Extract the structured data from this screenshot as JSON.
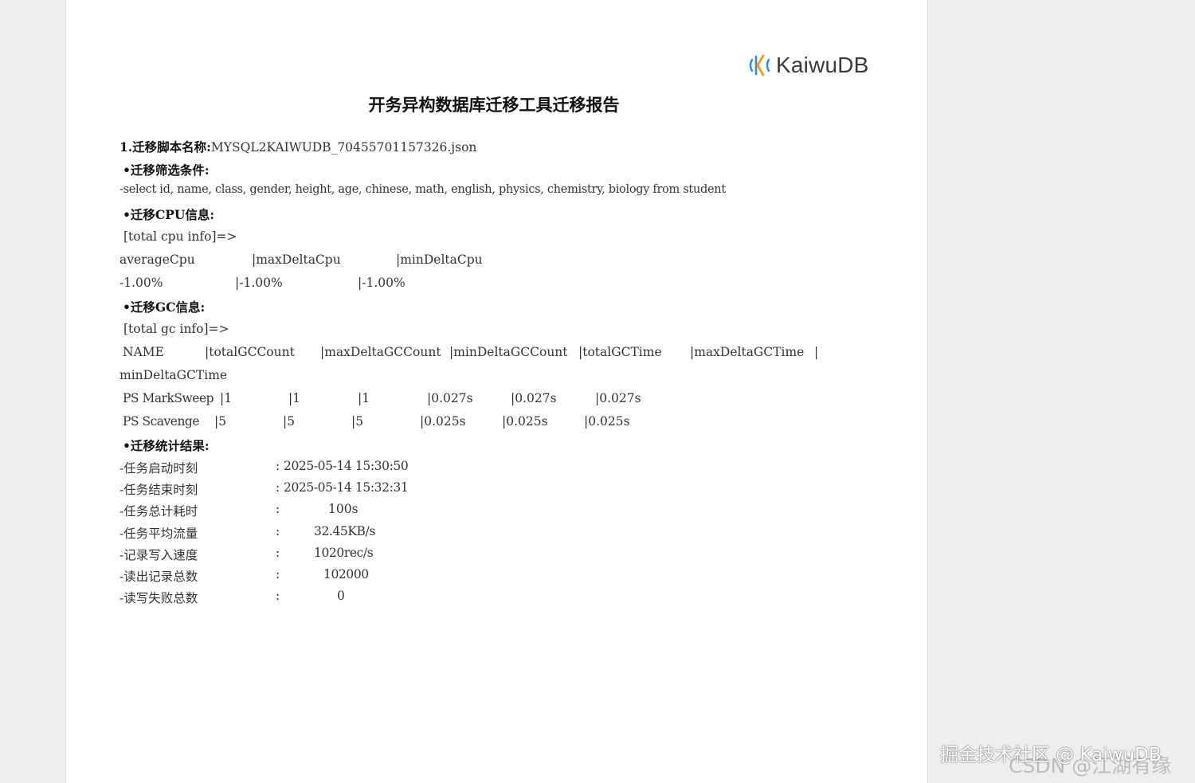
{
  "logo": {
    "text": "KaiwuDB"
  },
  "title": "开务异构数据库迁移工具迁移报告",
  "script_name": {
    "label": "1.迁移脚本名称:",
    "value": "MYSQL2KAIWUDB_704557011573​26.json"
  },
  "filter": {
    "heading": "•迁移筛选条件:",
    "sql": "-select id, name, class, gender, height, age, chinese, math, english, physics, chemistry, biology from student"
  },
  "cpu": {
    "heading": "•迁移CPU信息:",
    "label": "[total cpu info]=>",
    "headers": [
      "averageCpu",
      "|maxDeltaCpu",
      "|minDeltaCpu"
    ],
    "values": [
      "-1.00%",
      "|-1.00%",
      "|-1.00%"
    ]
  },
  "gc": {
    "heading": "•迁移GC信息:",
    "label": "[total gc info]=>",
    "headers": [
      "NAME",
      "|totalGCCount",
      "|maxDeltaGCCount",
      "|minDeltaGCCount",
      "|totalGCTime",
      "|maxDeltaGCTime",
      "|"
    ],
    "header_wrap": "minDeltaGCTime",
    "rows": [
      [
        "PS MarkSweep",
        "|1",
        "|1",
        "|1",
        "|0.027s",
        "|0.027s",
        "|0.027s"
      ],
      [
        "PS Scavenge",
        "|5",
        "|5",
        "|5",
        "|0.025s",
        "|0.025s",
        "|0.025s"
      ]
    ]
  },
  "stats": {
    "heading": "•迁移统计结果:",
    "items": [
      {
        "label": "-任务启动时刻",
        "sep": ":",
        "value": "2025-05-14 15:30:50"
      },
      {
        "label": "-任务结束时刻",
        "sep": ":",
        "value": "2025-05-14 15:32:31"
      },
      {
        "label": "-任务总计耗时",
        "sep": ":",
        "value": "100s"
      },
      {
        "label": "-任务平均流量",
        "sep": ":",
        "value": "32.45KB/s"
      },
      {
        "label": "-记录写入速度",
        "sep": ":",
        "value": "1020rec/s"
      },
      {
        "label": "-读出记录总数",
        "sep": ":",
        "value": "102000"
      },
      {
        "label": "-读写失败总数",
        "sep": ":",
        "value": "0"
      }
    ]
  },
  "watermarks": {
    "primary": "掘金技术社区 @ KaiwuDB",
    "secondary": "CSDN @江湖有缘"
  },
  "colors": {
    "logo_blue": "#2f8fd8",
    "logo_orange": "#f0a020",
    "text": "#333333"
  }
}
